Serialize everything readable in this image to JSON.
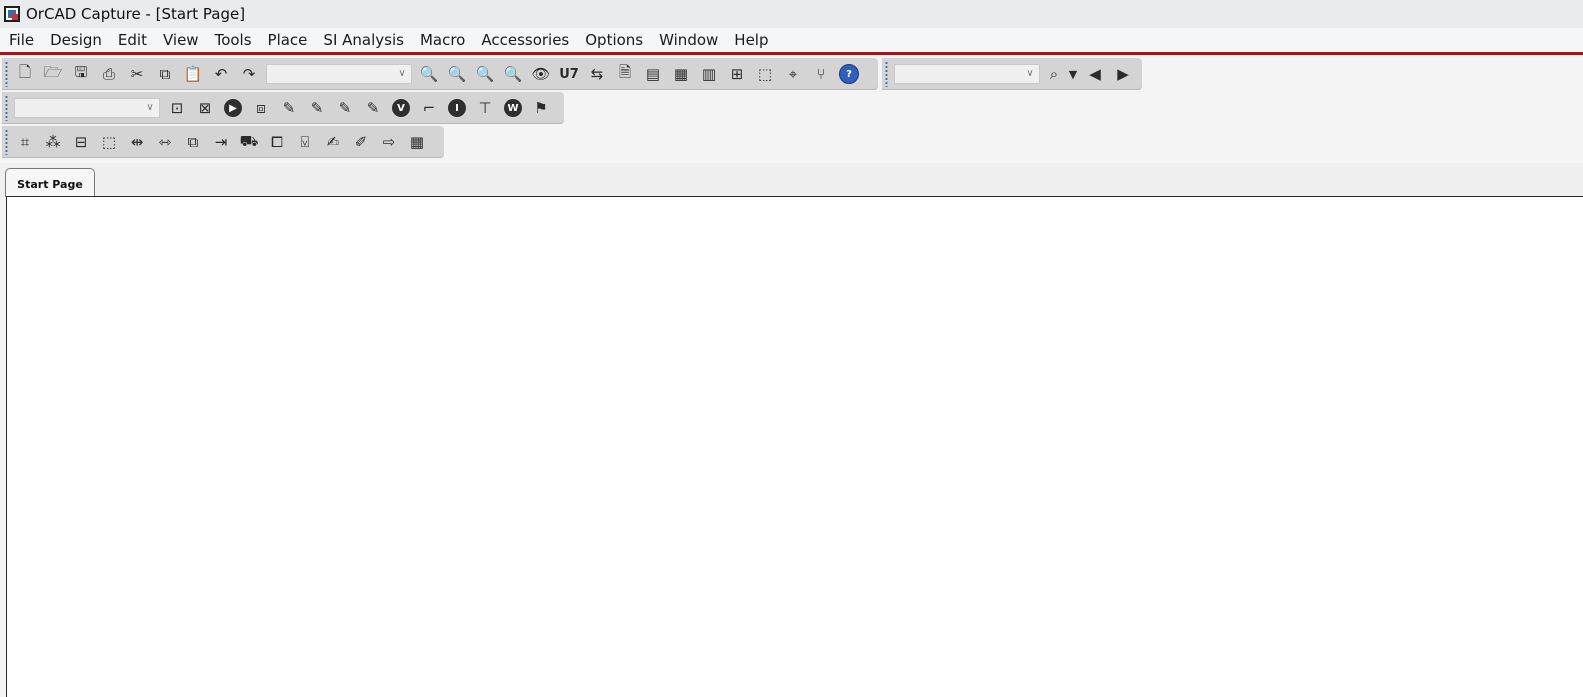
{
  "window": {
    "title": "OrCAD Capture - [Start Page]"
  },
  "menu": {
    "items": [
      "File",
      "Design",
      "Edit",
      "View",
      "Tools",
      "Place",
      "SI Analysis",
      "Macro",
      "Accessories",
      "Options",
      "Window",
      "Help"
    ]
  },
  "toolbars": {
    "main": {
      "icons": [
        "new-icon",
        "open-icon",
        "save-icon",
        "print-icon",
        "cut-icon",
        "copy-icon",
        "paste-icon",
        "undo-icon",
        "redo-icon"
      ],
      "combo_value": "",
      "icons_after_combo": [
        "zoom-in-icon",
        "zoom-out-icon",
        "zoom-area-icon",
        "zoom-all-icon",
        "eye-icon",
        "annotate-icon",
        "back-annotate-icon",
        "drc-icon",
        "netlist-icon",
        "cross-reference-icon",
        "bill-of-materials-icon",
        "snap-to-grid-icon",
        "area-select-icon",
        "drag-connected-icon",
        "usb-icon",
        "help-icon"
      ],
      "annotate_label": "U7",
      "help_label": "?"
    },
    "search": {
      "combo_value": "",
      "icons": [
        "binoculars-icon",
        "dropdown-arrow-icon",
        "previous-icon",
        "next-icon"
      ]
    },
    "simulation": {
      "combo_value": "",
      "icons": [
        "new-simulation-profile-icon",
        "edit-simulation-settings-icon",
        "run-icon",
        "view-simulation-results-icon",
        "voltage-marker-icon",
        "voltage-differential-marker-icon",
        "current-marker-icon",
        "power-marker-icon",
        "bias-voltage-icon",
        "voltage-level-icon",
        "bias-current-icon",
        "current-level-icon",
        "bias-power-icon",
        "power-level-icon"
      ],
      "bias_voltage_label": "V",
      "bias_current_label": "I",
      "bias_power_label": "W"
    },
    "pcb": {
      "icons": [
        "pcb-editor-icon",
        "generate-pcb-icon",
        "place-database-part-icon",
        "update-footprint-icon",
        "pin-swap-icon",
        "gate-swap-icon",
        "engineering-change-icon",
        "export-icon",
        "part-manager-icon",
        "copy-properties-icon",
        "variant-icon",
        "edit-properties-icon",
        "rename-icon",
        "output-icon",
        "property-table-icon"
      ]
    }
  },
  "tabs": [
    {
      "label": "Start Page",
      "active": true
    }
  ]
}
